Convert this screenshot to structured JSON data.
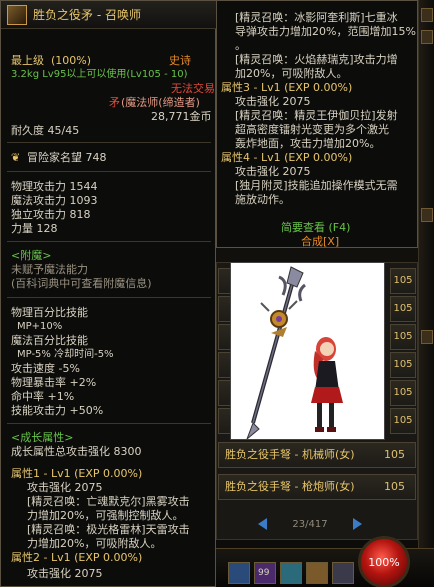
{
  "item": {
    "name": "胜负之役矛 - 召唤师",
    "level_label": "最上级",
    "level_pct": "(100%)",
    "rarity": "史诗",
    "weight_req": "3.2kg  Lv95以上可以使用(Lv105 - 10)",
    "trade": "无法交易",
    "type": "矛",
    "type_job": "(魔法师(缔造者)",
    "price": "28,771金币",
    "durability": "耐久度 45/45",
    "adventurer_fame": "冒险家名望 748",
    "stats": [
      "物理攻击力 1544",
      "魔法攻击力 1093",
      "独立攻击力 818",
      "力量 128"
    ],
    "enchant_title": "<附魔>",
    "enchant_lines": [
      "未赋予魔法能力",
      "(百科词典中可查看附魔信息)"
    ],
    "skills": [
      "物理百分比技能",
      "MP+10%",
      "魔法百分比技能",
      "MP-5% 冷却时间-5%",
      "攻击速度 -5%",
      "物理暴击率 +2%",
      "命中率 +1%",
      "技能攻击力 +50%"
    ],
    "growth_title": "<成长属性>",
    "growth_total": "成长属性总攻击强化 8300",
    "attr1_head": "属性1 - Lv1 (EXP 0.00%)",
    "attr1_power": "攻击强化 2075",
    "attr1_lines": [
      "[精灵召唤：亡魂默克尔]黑雾攻击",
      "力增加20%，可强制控制敌人。",
      "[精灵召唤：极光格雷林]天雷攻击",
      "力增加20%，可吸附敌人。"
    ],
    "attr2_head": "属性2 - Lv1 (EXP 0.00%)",
    "attr2_power": "攻击强化 2075"
  },
  "right_tip": {
    "lines_top": [
      "[精灵召唤：冰影阿奎利斯]七重冰",
      "导弹攻击力增加20%，范围增加15%",
      "。",
      "[精灵召唤：火焰赫瑞克]攻击力增",
      "加20%，可吸附敌人。"
    ],
    "attr3_head": "属性3 - Lv1 (EXP 0.00%)",
    "attr3_power": "攻击强化 2075",
    "attr3_lines": [
      "[精灵召唤：精灵王伊伽贝拉]发射",
      "超高密度镭射光变更为多个激光",
      "轰炸地面，攻击力增加20%。"
    ],
    "attr4_head": "属性4 - Lv1 (EXP 0.00%)",
    "attr4_power": "攻击强化 2075",
    "attr4_lines": [
      "[独月附灵]技能追加操作模式无需",
      "施放动作。"
    ],
    "brief_view": "简要查看 (F4)",
    "compose": "合成[X]"
  },
  "list": {
    "items": [
      {
        "name": "胜负之役手弩 - 机械师(女)",
        "level": "105"
      },
      {
        "name": "胜负之役手弩 - 枪炮师(女)",
        "level": "105"
      }
    ],
    "stub_levels": [
      "105",
      "105",
      "105",
      "105",
      "105",
      "105"
    ],
    "page": "23/417"
  },
  "hud": {
    "hp_percent": "100%",
    "slot_count": "99"
  },
  "colors": {
    "gold": "#e6c56c",
    "epic": "#e48a2a",
    "green": "#67c24a",
    "red": "#e04a3a"
  }
}
